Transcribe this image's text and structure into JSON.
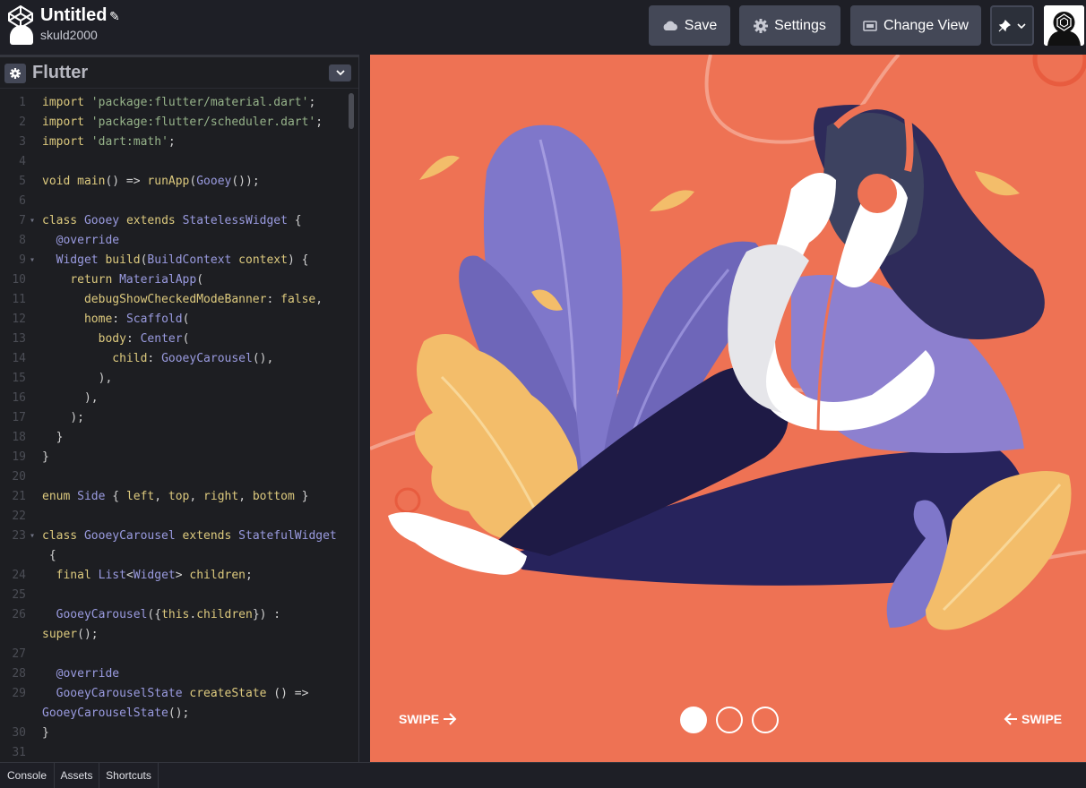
{
  "header": {
    "title": "Untitled",
    "username": "skuld2000",
    "buttons": {
      "save": "Save",
      "settings": "Settings",
      "change_view": "Change View"
    }
  },
  "editor": {
    "language": "Flutter",
    "lines": [
      {
        "n": "1",
        "fold": "",
        "html": "<span class=\"k\">import</span> <span class=\"s\">'package:flutter/material.dart'</span><span class=\"p\">;</span>"
      },
      {
        "n": "2",
        "fold": "",
        "html": "<span class=\"k\">import</span> <span class=\"s\">'package:flutter/scheduler.dart'</span><span class=\"p\">;</span>"
      },
      {
        "n": "3",
        "fold": "",
        "html": "<span class=\"k\">import</span> <span class=\"s\">'dart:math'</span><span class=\"p\">;</span>"
      },
      {
        "n": "4",
        "fold": "",
        "html": ""
      },
      {
        "n": "5",
        "fold": "",
        "html": "<span class=\"k\">void</span> <span class=\"k\">main</span><span class=\"p\">() =&gt; </span><span class=\"k\">runApp</span><span class=\"p\">(</span><span class=\"t\">Gooey</span><span class=\"p\">());</span>"
      },
      {
        "n": "6",
        "fold": "",
        "html": ""
      },
      {
        "n": "7",
        "fold": "▾",
        "html": "<span class=\"k\">class</span> <span class=\"t\">Gooey</span> <span class=\"k\">extends</span> <span class=\"t\">StatelessWidget</span> <span class=\"p\">{</span>"
      },
      {
        "n": "8",
        "fold": "",
        "html": "  <span class=\"t\">@override</span>"
      },
      {
        "n": "9",
        "fold": "▾",
        "html": "  <span class=\"t\">Widget</span> <span class=\"k\">build</span><span class=\"p\">(</span><span class=\"t\">BuildContext</span> <span class=\"k\">context</span><span class=\"p\">) {</span>"
      },
      {
        "n": "10",
        "fold": "",
        "html": "    <span class=\"k\">return</span> <span class=\"t\">MaterialApp</span><span class=\"p\">(</span>"
      },
      {
        "n": "11",
        "fold": "",
        "html": "      <span class=\"k\">debugShowCheckedModeBanner</span><span class=\"p\">: </span><span class=\"k\">false</span><span class=\"p\">,</span>"
      },
      {
        "n": "12",
        "fold": "",
        "html": "      <span class=\"k\">home</span><span class=\"p\">: </span><span class=\"t\">Scaffold</span><span class=\"p\">(</span>"
      },
      {
        "n": "13",
        "fold": "",
        "html": "        <span class=\"k\">body</span><span class=\"p\">: </span><span class=\"t\">Center</span><span class=\"p\">(</span>"
      },
      {
        "n": "14",
        "fold": "",
        "html": "          <span class=\"k\">child</span><span class=\"p\">: </span><span class=\"t\">GooeyCarousel</span><span class=\"p\">(),</span>"
      },
      {
        "n": "15",
        "fold": "",
        "html": "        <span class=\"p\">),</span>"
      },
      {
        "n": "16",
        "fold": "",
        "html": "      <span class=\"p\">),</span>"
      },
      {
        "n": "17",
        "fold": "",
        "html": "    <span class=\"p\">);</span>"
      },
      {
        "n": "18",
        "fold": "",
        "html": "  <span class=\"p\">}</span>"
      },
      {
        "n": "19",
        "fold": "",
        "html": "<span class=\"p\">}</span>"
      },
      {
        "n": "20",
        "fold": "",
        "html": ""
      },
      {
        "n": "21",
        "fold": "",
        "html": "<span class=\"k\">enum</span> <span class=\"t\">Side</span> <span class=\"p\">{ </span><span class=\"k\">left</span><span class=\"p\">, </span><span class=\"k\">top</span><span class=\"p\">, </span><span class=\"k\">right</span><span class=\"p\">, </span><span class=\"k\">bottom</span> <span class=\"p\">}</span>"
      },
      {
        "n": "22",
        "fold": "",
        "html": ""
      },
      {
        "n": "23",
        "fold": "▾",
        "html": "<span class=\"k\">class</span> <span class=\"t\">GooeyCarousel</span> <span class=\"k\">extends</span> <span class=\"t\">StatefulWidget</span>"
      },
      {
        "n": "",
        "fold": "",
        "html": " <span class=\"p\">{</span>"
      },
      {
        "n": "24",
        "fold": "",
        "html": "  <span class=\"k\">final</span> <span class=\"t\">List</span><span class=\"p\">&lt;</span><span class=\"t\">Widget</span><span class=\"p\">&gt; </span><span class=\"k\">children</span><span class=\"p\">;</span>"
      },
      {
        "n": "25",
        "fold": "",
        "html": ""
      },
      {
        "n": "26",
        "fold": "",
        "html": "  <span class=\"t\">GooeyCarousel</span><span class=\"p\">({</span><span class=\"k\">this</span><span class=\"p\">.</span><span class=\"k\">children</span><span class=\"p\">}) :</span>"
      },
      {
        "n": "",
        "fold": "",
        "html": "<span class=\"k\">super</span><span class=\"p\">();</span>"
      },
      {
        "n": "27",
        "fold": "",
        "html": ""
      },
      {
        "n": "28",
        "fold": "",
        "html": "  <span class=\"t\">@override</span>"
      },
      {
        "n": "29",
        "fold": "",
        "html": "  <span class=\"t\">GooeyCarouselState</span> <span class=\"k\">createState</span> <span class=\"p\">() =&gt;</span>"
      },
      {
        "n": "",
        "fold": "",
        "html": "<span class=\"t\">GooeyCarouselState</span><span class=\"p\">();</span>"
      },
      {
        "n": "30",
        "fold": "",
        "html": "<span class=\"p\">}</span>"
      },
      {
        "n": "31",
        "fold": "",
        "html": ""
      }
    ]
  },
  "preview": {
    "swipe_left": "SWIPE",
    "swipe_right": "SWIPE",
    "active_page": 1,
    "page_count": 3
  },
  "bottom_tabs": {
    "console": "Console",
    "assets": "Assets",
    "shortcuts": "Shortcuts"
  },
  "colors": {
    "preview_bg": "#ee7254",
    "editor_bg": "#1d1e22",
    "button_bg": "#444857"
  }
}
